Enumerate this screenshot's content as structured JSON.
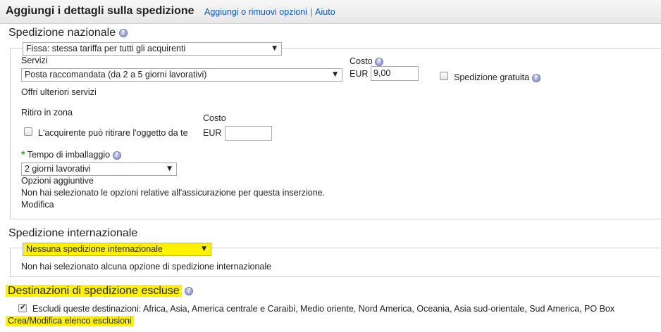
{
  "header": {
    "title": "Aggiungi i dettagli sulla spedizione",
    "link_options": "Aggiungi o rimuovi opzioni",
    "separator": "|",
    "link_help": "Aiuto"
  },
  "domestic": {
    "title": "Spedizione nazionale",
    "type_select": "Fissa: stessa tariffa per tutti gli acquirenti",
    "services_label": "Servizi",
    "service_select": "Posta raccomandata (da 2 a 5 giorni lavorativi)",
    "cost_label": "Costo",
    "currency": "EUR",
    "cost_value": "9,00",
    "free_shipping_label": "Spedizione gratuita",
    "more_services_link": "Offri ulteriori servizi",
    "pickup_title": "Ritiro in zona",
    "pickup_checkbox_label": "L'acquirente può ritirare l'oggetto da te",
    "pickup_cost_label": "Costo",
    "pickup_currency": "EUR",
    "pickup_cost_value": "",
    "handling_marker": "*",
    "handling_label": "Tempo di imballaggio",
    "handling_select": "2 giorni lavorativi",
    "extra_options_label": "Opzioni aggiuntive",
    "insurance_text": "Non hai selezionato le opzioni relative all'assicurazione per questa inserzione.",
    "modify_link": "Modifica"
  },
  "international": {
    "title": "Spedizione internazionale",
    "select": "Nessuna spedizione internazionale",
    "status_text": "Non hai selezionato alcuna opzione di spedizione internazionale"
  },
  "excluded": {
    "title": "Destinazioni di spedizione escluse",
    "checkbox_label": "Escludi queste destinazioni: Africa, Asia, America centrale e Caraibi, Medio oriente, Nord America, Oceania, Asia sud-orientale, Sud America, PO Box",
    "checkbox_checked": true,
    "edit_link": "Crea/Modifica elenco esclusioni"
  },
  "icons": {
    "help": "?",
    "dropdown_arrow": "▼",
    "checkmark": "✔"
  },
  "colors": {
    "link": "#0654ba",
    "highlight": "#fff200",
    "required": "#3aa036"
  }
}
